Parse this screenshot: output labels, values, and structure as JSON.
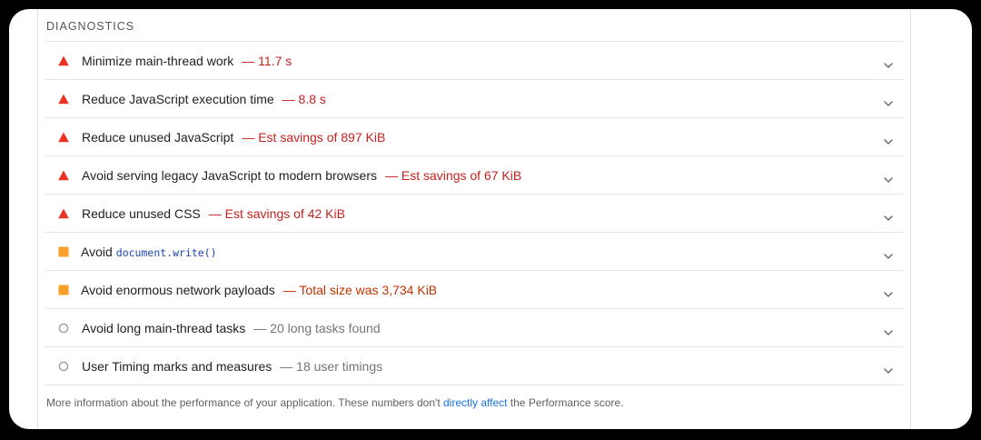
{
  "section": {
    "title": "DIAGNOSTICS"
  },
  "colors": {
    "fail": "#eb3323",
    "average": "#fa9e2a",
    "pass_ring": "#9e9e9e"
  },
  "audits": [
    {
      "status": "fail",
      "icon": "red-triangle-icon",
      "title": "Minimize main-thread work",
      "detail": "— 11.7 s"
    },
    {
      "status": "fail",
      "icon": "red-triangle-icon",
      "title": "Reduce JavaScript execution time",
      "detail": "— 8.8 s"
    },
    {
      "status": "fail",
      "icon": "red-triangle-icon",
      "title": "Reduce unused JavaScript",
      "detail": "— Est savings of 897 KiB"
    },
    {
      "status": "fail",
      "icon": "red-triangle-icon",
      "title": "Avoid serving legacy JavaScript to modern browsers",
      "detail": "— Est savings of 67 KiB"
    },
    {
      "status": "fail",
      "icon": "red-triangle-icon",
      "title": "Reduce unused CSS",
      "detail": "— Est savings of 42 KiB"
    },
    {
      "status": "average",
      "icon": "orange-square-icon",
      "title": "Avoid",
      "code": "document.write()"
    },
    {
      "status": "average",
      "icon": "orange-square-icon",
      "title": "Avoid enormous network payloads",
      "detail": "— Total size was 3,734 KiB"
    },
    {
      "status": "info",
      "icon": "gray-circle-icon",
      "title": "Avoid long main-thread tasks",
      "detail": "— 20 long tasks found"
    },
    {
      "status": "info",
      "icon": "gray-circle-icon",
      "title": "User Timing marks and measures",
      "detail": "— 18 user timings"
    }
  ],
  "footer": {
    "text_before": "More information about the performance of your application. These numbers don't ",
    "link_text": "directly affect",
    "text_after": " the Performance score."
  }
}
